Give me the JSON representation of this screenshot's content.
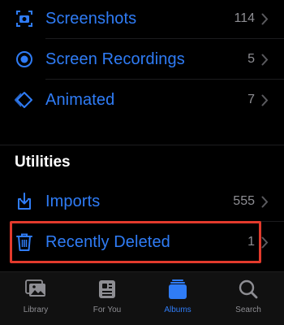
{
  "albums": [
    {
      "label": "Screenshots",
      "count": "114",
      "icon": "screenshot-icon"
    },
    {
      "label": "Screen Recordings",
      "count": "5",
      "icon": "screen-recording-icon"
    },
    {
      "label": "Animated",
      "count": "7",
      "icon": "animated-icon"
    }
  ],
  "utilities": {
    "title": "Utilities",
    "items": [
      {
        "label": "Imports",
        "count": "555",
        "icon": "import-icon"
      },
      {
        "label": "Recently Deleted",
        "count": "1",
        "icon": "trash-icon"
      }
    ]
  },
  "tabbar": {
    "tabs": [
      {
        "label": "Library",
        "icon": "library-icon",
        "active": false
      },
      {
        "label": "For You",
        "icon": "for-you-icon",
        "active": false
      },
      {
        "label": "Albums",
        "icon": "albums-icon",
        "active": true
      },
      {
        "label": "Search",
        "icon": "search-icon",
        "active": false
      }
    ]
  },
  "colors": {
    "accent": "#2f7cf6",
    "highlight": "#e23a2c",
    "background": "#000000",
    "secondary_text": "#8e8e93"
  }
}
